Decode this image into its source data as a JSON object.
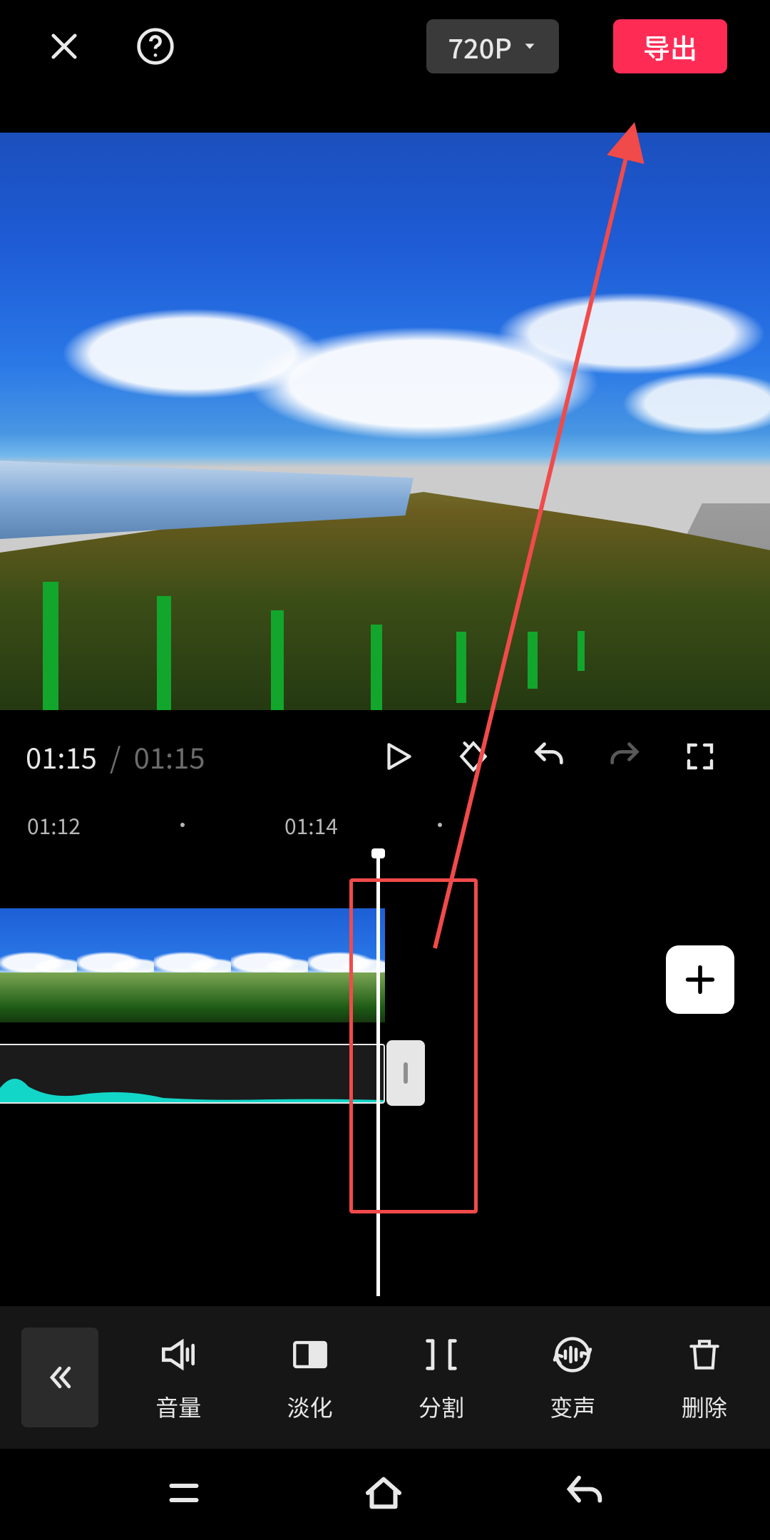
{
  "header": {
    "resolution_label": "720P",
    "export_label": "导出"
  },
  "playback": {
    "current_time": "01:15",
    "duration": "01:15"
  },
  "timeline": {
    "ruler_ticks": [
      "01:12",
      "01:14"
    ],
    "add_label": "+"
  },
  "toolbar": {
    "items": [
      {
        "id": "volume",
        "label": "音量"
      },
      {
        "id": "fade",
        "label": "淡化"
      },
      {
        "id": "split",
        "label": "分割"
      },
      {
        "id": "voice",
        "label": "变声"
      },
      {
        "id": "delete",
        "label": "删除"
      }
    ]
  },
  "annotation": {
    "highlight_color": "#f14a4a"
  }
}
